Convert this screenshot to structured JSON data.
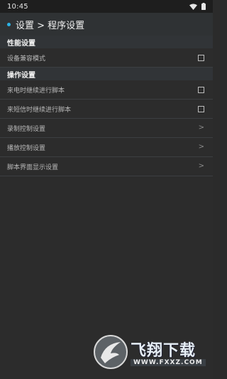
{
  "status_bar": {
    "time": "10:45",
    "icons": [
      "wifi-icon",
      "battery-icon"
    ]
  },
  "header": {
    "title": "设置 > 程序设置",
    "accent_color": "#2bb3e6"
  },
  "sections": [
    {
      "title": "性能设置",
      "items": [
        {
          "label": "设备兼容模式",
          "control": "checkbox",
          "checked": false
        }
      ]
    },
    {
      "title": "操作设置",
      "items": [
        {
          "label": "来电时继续进行脚本",
          "control": "checkbox",
          "checked": false
        },
        {
          "label": "来短信时继续进行脚本",
          "control": "checkbox",
          "checked": false
        },
        {
          "label": "录制控制设置",
          "control": "chevron"
        },
        {
          "label": "播放控制设置",
          "control": "chevron"
        },
        {
          "label": "脚本界面显示设置",
          "control": "chevron"
        }
      ]
    }
  ],
  "chevron_glyph": ">",
  "watermark": {
    "brand": "飞翔下载",
    "url": "WWW.FXXZ.COM"
  }
}
